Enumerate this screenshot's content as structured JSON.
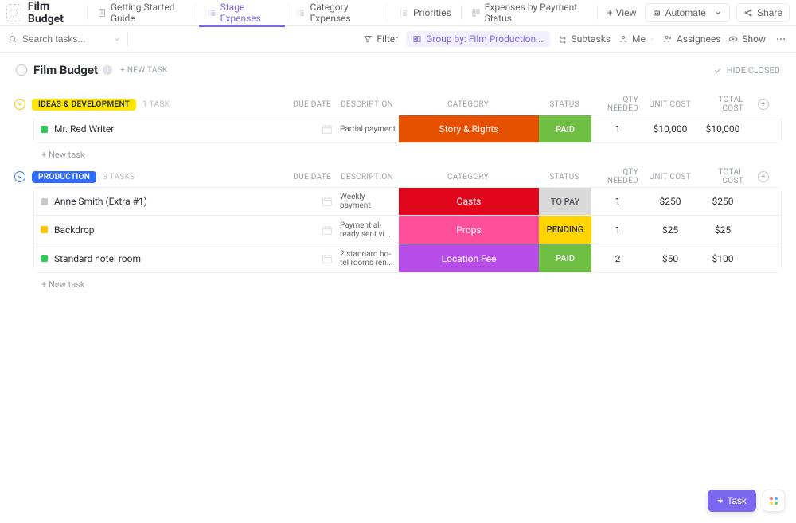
{
  "header": {
    "title": "Film Budget",
    "tabs": [
      {
        "label": "Getting Started Guide"
      },
      {
        "label": "Stage Expenses"
      },
      {
        "label": "Category Expenses"
      },
      {
        "label": "Priorities"
      },
      {
        "label": "Expenses by Payment Status"
      }
    ],
    "addView": "View",
    "automate": "Automate",
    "share": "Share"
  },
  "toolbar": {
    "searchPlaceholder": "Search tasks...",
    "filter": "Filter",
    "groupBy": "Group by: Film Production...",
    "subtasks": "Subtasks",
    "me": "Me",
    "assignees": "Assignees",
    "show": "Show"
  },
  "listHead": {
    "title": "Film Budget",
    "newTask": "+ NEW TASK",
    "hideClosed": "HIDE CLOSED"
  },
  "columns": {
    "dueDate": "DUE DATE",
    "description": "DESCRIPTION",
    "category": "CATEGORY",
    "status": "STATUS",
    "qtyNeeded": "QTY NEEDED",
    "unitCost": "UNIT COST",
    "totalCost": "TOTAL COST"
  },
  "groups": [
    {
      "id": "ideas",
      "name": "IDEAS & DEVELOPMENT",
      "badgeColor": "yellow",
      "toggle": "y",
      "count": "1 TASK",
      "rows": [
        {
          "sq": "green",
          "task": "Mr. Red Writer",
          "desc": "Partial payment",
          "cat": {
            "label": "Story & Rights",
            "bg": "#e65100"
          },
          "status": {
            "label": "PAID",
            "bg": "#6fbf44",
            "fg": "#fff"
          },
          "qty": "1",
          "unit": "$10,000",
          "total": "$10,000"
        }
      ]
    },
    {
      "id": "prod",
      "name": "PRODUCTION",
      "badgeColor": "blue",
      "toggle": "b",
      "count": "3 TASKS",
      "rows": [
        {
          "sq": "grey",
          "task": "Anne Smith (Extra #1)",
          "desc": "Weekly payment",
          "cat": {
            "label": "Casts",
            "bg": "#e1061c"
          },
          "status": {
            "label": "TO PAY",
            "bg": "#d9d9d9",
            "fg": "#55595e"
          },
          "qty": "1",
          "unit": "$250",
          "total": "$250"
        },
        {
          "sq": "yellow",
          "task": "Backdrop",
          "desc": "Payment al­ready sent vi...",
          "cat": {
            "label": "Props",
            "bg": "#ff4f9a"
          },
          "status": {
            "label": "PENDING",
            "bg": "#ffd400",
            "fg": "#2a2e34"
          },
          "qty": "1",
          "unit": "$25",
          "total": "$25"
        },
        {
          "sq": "green",
          "task": "Standard hotel room",
          "desc": "2 standard ho­tel rooms ren...",
          "cat": {
            "label": "Location Fee",
            "bg": "#b84eea"
          },
          "status": {
            "label": "PAID",
            "bg": "#6fbf44",
            "fg": "#fff"
          },
          "qty": "2",
          "unit": "$50",
          "total": "$100"
        }
      ]
    }
  ],
  "misc": {
    "newTaskRow": "+ New task",
    "taskButton": "Task"
  }
}
